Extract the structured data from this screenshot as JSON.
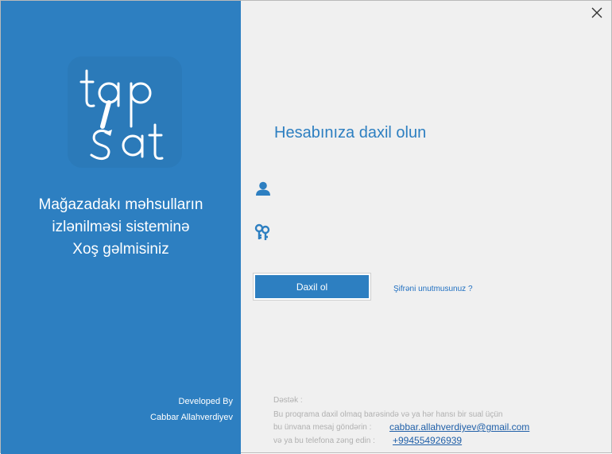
{
  "branding": {
    "logo_line1": "tap",
    "logo_line2": "s'at",
    "welcome_line1": "Mağazadakı məhsulların",
    "welcome_line2": "izlənilməsi sisteminə",
    "welcome_line3": "Xoş gəlmisiniz",
    "developed_by_label": "Developed By",
    "developer_name": "Cabbar Allahverdiyev"
  },
  "login": {
    "heading": "Hesabınıza daxil olun",
    "username_value": "",
    "password_value": "",
    "login_button_label": "Daxil ol",
    "forgot_password_link": "Şifrəni unutmusunuz ?"
  },
  "support": {
    "title": "Dəstək :",
    "line1": "Bu proqrama daxil olmaq barəsində və ya hər hansı bir sual üçün",
    "line2_label": "bu ünvana mesaj göndərin :",
    "email": "cabbar.allahverdiyev@gmail.com",
    "line3_label": "və ya bu telefona zəng edin :",
    "phone": "+994554926939"
  },
  "window": {
    "close_symbol": "✕"
  },
  "colors": {
    "accent": "#2d7fc1",
    "panel_bg": "#f0f0f0",
    "link": "#1f6fc1"
  },
  "icons": {
    "user": "user-icon",
    "password": "keys-icon",
    "close": "close-icon"
  }
}
